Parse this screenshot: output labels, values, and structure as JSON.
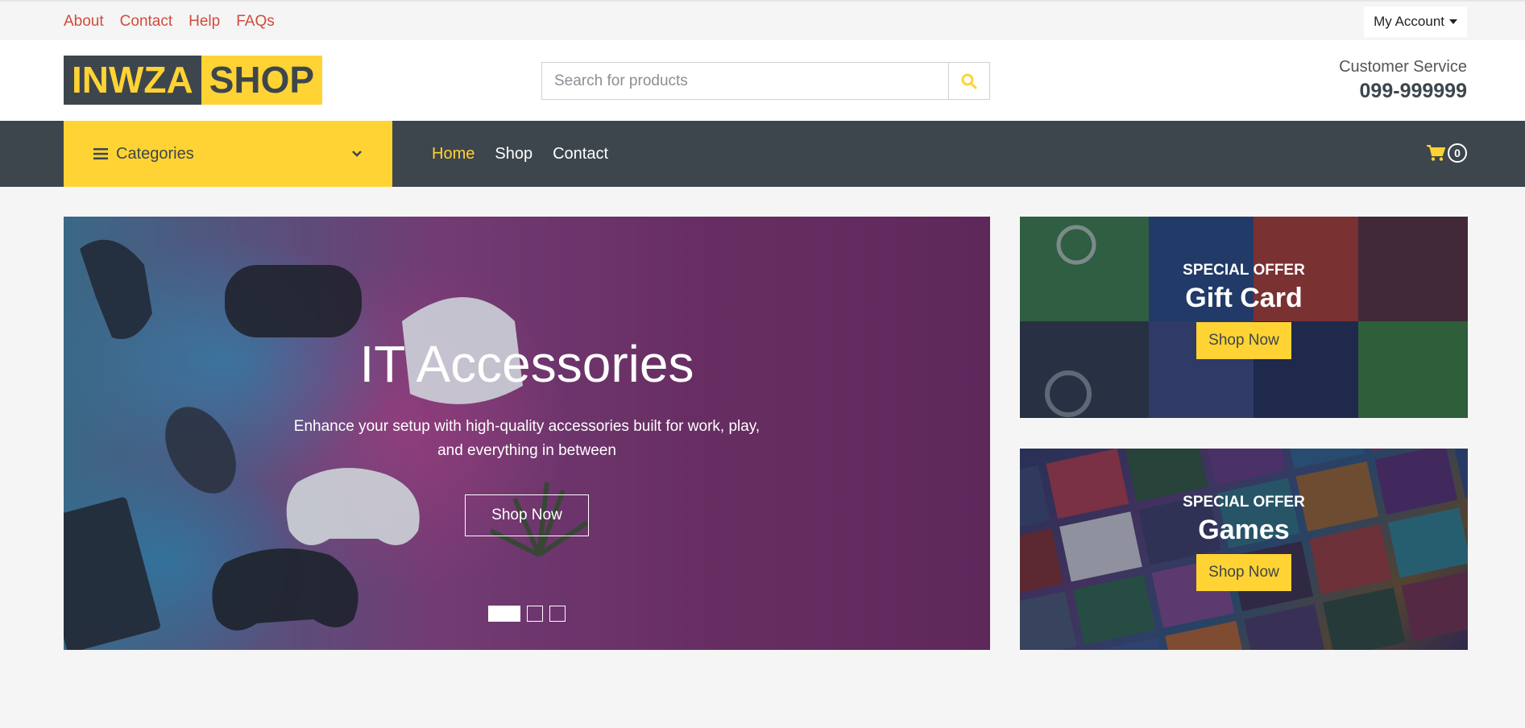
{
  "topbar": {
    "links": [
      "About",
      "Contact",
      "Help",
      "FAQs"
    ],
    "account_label": "My Account"
  },
  "header": {
    "logo_part1": "INWZA",
    "logo_part2": "SHOP",
    "search_placeholder": "Search for products",
    "customer_service_label": "Customer Service",
    "customer_service_phone": "099-999999"
  },
  "nav": {
    "categories_label": "Categories",
    "links": [
      "Home",
      "Shop",
      "Contact"
    ],
    "active_link": "Home",
    "cart_count": "0"
  },
  "hero": {
    "title": "IT Accessories",
    "subtitle": "Enhance your setup with high-quality accessories built for work, play, and everything in between",
    "button_label": "Shop Now",
    "slide_count": 3,
    "active_slide": 1
  },
  "offers": [
    {
      "kicker": "SPECIAL OFFER",
      "title": "Gift Card",
      "button_label": "Shop Now"
    },
    {
      "kicker": "SPECIAL OFFER",
      "title": "Games",
      "button_label": "Shop Now"
    }
  ],
  "colors": {
    "accent": "#ffd333",
    "dark": "#3d464d",
    "link": "#d14b3a"
  }
}
